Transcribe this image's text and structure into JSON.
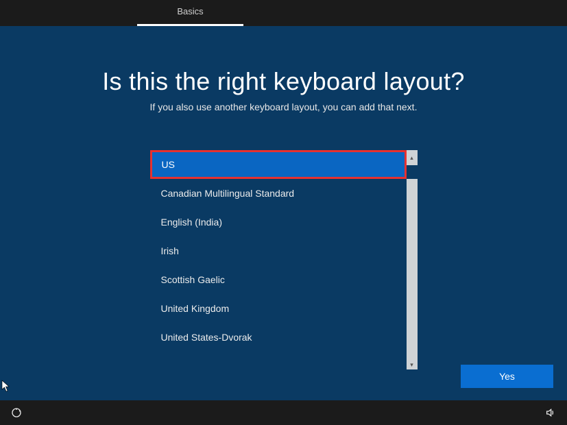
{
  "tab": {
    "label": "Basics"
  },
  "title": "Is this the right keyboard layout?",
  "subtitle": "If you also use another keyboard layout, you can add that next.",
  "layouts": {
    "selected": "US",
    "items": [
      "Canadian Multilingual Standard",
      "English (India)",
      "Irish",
      "Scottish Gaelic",
      "United Kingdom",
      "United States-Dvorak"
    ]
  },
  "buttons": {
    "yes": "Yes"
  }
}
